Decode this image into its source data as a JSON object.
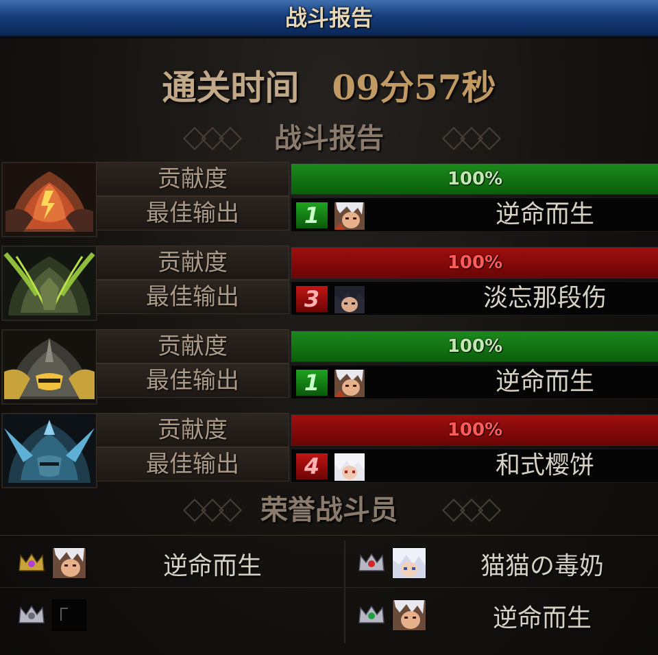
{
  "header": {
    "title": "战斗报告"
  },
  "clear_time": {
    "label": "通关时间",
    "value": "09分57秒"
  },
  "section_report": {
    "title": "战斗报告"
  },
  "players": [
    {
      "contribution_label": "贡献度",
      "contribution_value": "100%",
      "contribution_fraction": 1.0,
      "bar_color": "green",
      "best_output_label": "最佳输出",
      "rank": "1",
      "rank_color": "green",
      "name": "逆命而生",
      "emblem": "flame-helmet-icon"
    },
    {
      "contribution_label": "贡献度",
      "contribution_value": "100%",
      "contribution_fraction": 1.0,
      "bar_color": "red",
      "best_output_label": "最佳输出",
      "rank": "3",
      "rank_color": "red",
      "name": "淡忘那段伤",
      "emblem": "green-horned-helmet-icon"
    },
    {
      "contribution_label": "贡献度",
      "contribution_value": "100%",
      "contribution_fraction": 1.0,
      "bar_color": "green",
      "best_output_label": "最佳输出",
      "rank": "1",
      "rank_color": "green",
      "name": "逆命而生",
      "emblem": "gold-spiked-helmet-icon"
    },
    {
      "contribution_label": "贡献度",
      "contribution_value": "100%",
      "contribution_fraction": 1.0,
      "bar_color": "red",
      "best_output_label": "最佳输出",
      "rank": "4",
      "rank_color": "red",
      "name": "和式樱饼",
      "emblem": "ice-helmet-icon"
    }
  ],
  "section_honor": {
    "title": "荣誉战斗员"
  },
  "honor": [
    {
      "name": "逆命而生",
      "crown_gem": "purple"
    },
    {
      "name": "猫猫の毒奶",
      "crown_gem": "red"
    },
    {
      "name": "",
      "crown_gem": "none"
    },
    {
      "name": "逆命而生",
      "crown_gem": "green"
    }
  ],
  "colors": {
    "title_bar": "#173e7c",
    "bar_green": "#1c8a1c",
    "bar_red": "#a00f0f",
    "text_gold": "#c09a62"
  }
}
